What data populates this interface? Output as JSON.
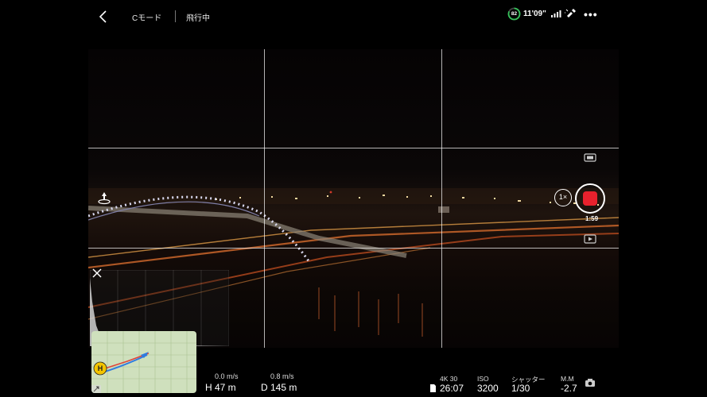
{
  "header": {
    "mode": "Cモード",
    "status": "飛行中",
    "battery": "82",
    "flight_time": "11'09\""
  },
  "camera": {
    "zoom": "1×",
    "record_time": "1:59"
  },
  "telemetry": {
    "h_speed": "0.0 m/s",
    "height_label": "H",
    "height": "47 m",
    "v_speed": "0.8 m/s",
    "dist_label": "D",
    "distance": "145 m"
  },
  "camera_params": {
    "resolution": "4K 30",
    "storage": "26:07",
    "iso_label": "ISO",
    "iso": "3200",
    "shutter_label": "シャッター",
    "shutter": "1/30",
    "ev_label": "M.M",
    "ev": "-2.7"
  },
  "map": {
    "home_label": "H"
  },
  "colors": {
    "record": "#e8212d",
    "battery_ring": "#35c45a",
    "map_bg": "#cfe0bd",
    "home": "#f3c400"
  }
}
